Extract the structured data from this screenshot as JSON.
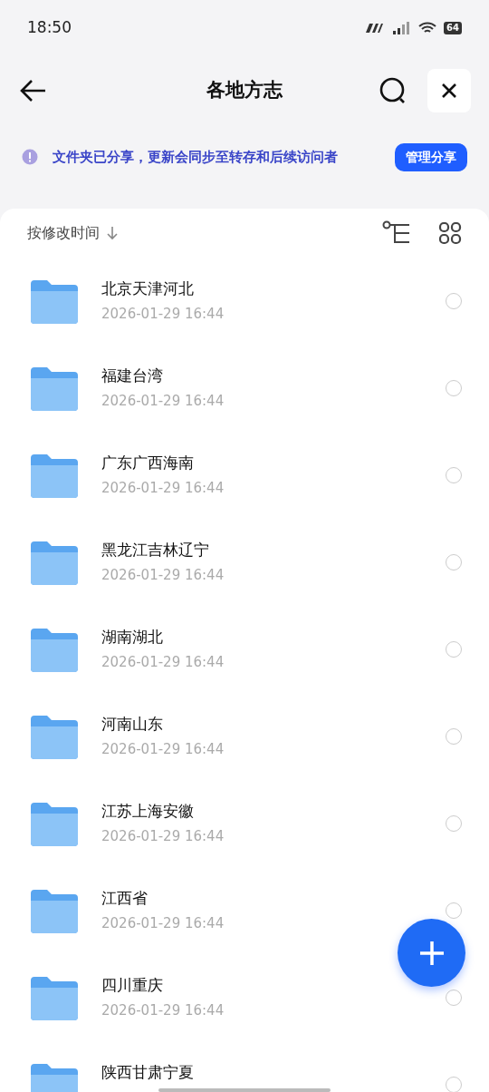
{
  "status_bar": {
    "time": "18:50",
    "battery": "64"
  },
  "header": {
    "title": "各地方志"
  },
  "share_banner": {
    "message": "文件夹已分享，更新会同步至转存和后续访问者",
    "button": "管理分享"
  },
  "sort": {
    "label": "按修改时间"
  },
  "folders": [
    {
      "name": "北京天津河北",
      "date": "2026-01-29 16:44",
      "selected": false
    },
    {
      "name": "福建台湾",
      "date": "2026-01-29 16:44",
      "selected": false
    },
    {
      "name": "广东广西海南",
      "date": "2026-01-29 16:44",
      "selected": false
    },
    {
      "name": "黑龙江吉林辽宁",
      "date": "2026-01-29 16:44",
      "selected": false
    },
    {
      "name": "湖南湖北",
      "date": "2026-01-29 16:44",
      "selected": false
    },
    {
      "name": "河南山东",
      "date": "2026-01-29 16:44",
      "selected": false
    },
    {
      "name": "江苏上海安徽",
      "date": "2026-01-29 16:44",
      "selected": false
    },
    {
      "name": "江西省",
      "date": "2026-01-29 16:44",
      "selected": false
    },
    {
      "name": "四川重庆",
      "date": "2026-01-29 16:44",
      "selected": false
    },
    {
      "name": "陕西甘肃宁夏",
      "selected": false
    }
  ]
}
